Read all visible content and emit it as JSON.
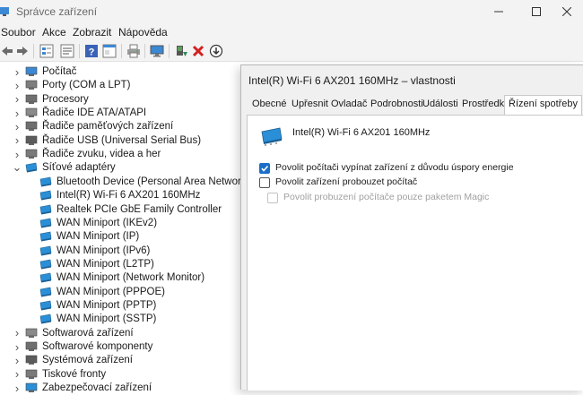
{
  "window": {
    "title": "Správce zařízení"
  },
  "menu": [
    "Soubor",
    "Akce",
    "Zobrazit",
    "Nápověda"
  ],
  "toolbar": {
    "icons": [
      "back-arrow-icon",
      "forward-arrow-icon",
      "tree-view-icon",
      "properties-icon",
      "help-icon",
      "view-icon",
      "print-icon",
      "monitor-scan-icon",
      "update-driver-icon",
      "uninstall-icon",
      "download-icon"
    ]
  },
  "tree": {
    "items": [
      {
        "label": "Počítač",
        "expanded": false
      },
      {
        "label": "Porty (COM a LPT)",
        "expanded": false
      },
      {
        "label": "Procesory",
        "expanded": false
      },
      {
        "label": "Řadiče IDE ATA/ATAPI",
        "expanded": false
      },
      {
        "label": "Řadiče paměťových zařízení",
        "expanded": false
      },
      {
        "label": "Řadiče USB (Universal Serial Bus)",
        "expanded": false
      },
      {
        "label": "Řadiče zvuku, videa a her",
        "expanded": false
      },
      {
        "label": "Síťové adaptéry",
        "expanded": true
      },
      {
        "label": "Bluetooth Device (Personal Area Network)",
        "child": true
      },
      {
        "label": "Intel(R) Wi-Fi 6 AX201 160MHz",
        "child": true
      },
      {
        "label": "Realtek PCIe GbE Family Controller",
        "child": true
      },
      {
        "label": "WAN Miniport (IKEv2)",
        "child": true
      },
      {
        "label": "WAN Miniport (IP)",
        "child": true
      },
      {
        "label": "WAN Miniport (IPv6)",
        "child": true
      },
      {
        "label": "WAN Miniport (L2TP)",
        "child": true
      },
      {
        "label": "WAN Miniport (Network Monitor)",
        "child": true
      },
      {
        "label": "WAN Miniport (PPPOE)",
        "child": true
      },
      {
        "label": "WAN Miniport (PPTP)",
        "child": true
      },
      {
        "label": "WAN Miniport (SSTP)",
        "child": true
      },
      {
        "label": "Softwarová zařízení",
        "expanded": false
      },
      {
        "label": "Softwarové komponenty",
        "expanded": false
      },
      {
        "label": "Systémová zařízení",
        "expanded": false
      },
      {
        "label": "Tiskové fronty",
        "expanded": false
      },
      {
        "label": "Zabezpečovací zařízení",
        "expanded": false
      }
    ]
  },
  "dialog": {
    "title": "Intel(R) Wi-Fi 6 AX201 160MHz – vlastnosti",
    "tabs": [
      "Obecné",
      "Upřesnit",
      "Ovladač",
      "Podrobnosti",
      "Události",
      "Prostředky",
      "Řízení spotřeby"
    ],
    "active_tab": "Řízení spotřeby",
    "device_name": "Intel(R) Wi-Fi 6 AX201 160MHz",
    "options": [
      {
        "label": "Povolit počítači vypínat zařízení z důvodu úspory energie",
        "checked": true,
        "enabled": true
      },
      {
        "label": "Povolit zařízení probouzet počítač",
        "checked": false,
        "enabled": true
      },
      {
        "label": "Povolit probuzení počítače pouze paketem Magic",
        "checked": false,
        "enabled": false
      }
    ]
  },
  "colors": {
    "accent": "#1a6ec7",
    "chrome": "#f3f3f3",
    "dialog_bg": "#f0f0f0",
    "adapter_icon": "#2a8fd6"
  }
}
